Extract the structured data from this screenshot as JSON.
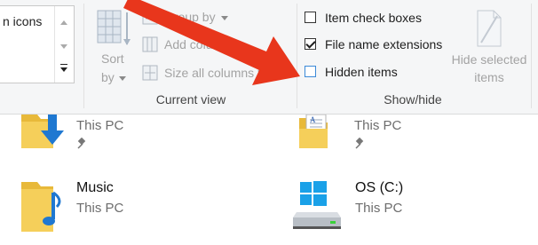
{
  "ribbon": {
    "layout_pane": {
      "icons_label": "n icons"
    },
    "current_view": {
      "sort_by_line1": "Sort",
      "sort_by_line2": "by",
      "group_by": "Group by",
      "add_columns": "Add columns",
      "size_all_columns": "Size all columns to fit",
      "group_label": "Current view"
    },
    "show_hide": {
      "item_check_boxes": {
        "label": "Item check boxes",
        "checked": false
      },
      "file_name_extensions": {
        "label": "File name extensions",
        "checked": true
      },
      "hidden_items": {
        "label": "Hidden items",
        "checked": false
      },
      "hide_selected_line1": "Hide selected",
      "hide_selected_line2": "items",
      "group_label": "Show/hide"
    }
  },
  "content": {
    "items": [
      {
        "name": "",
        "location": "This PC",
        "icon": "downloads-folder-icon"
      },
      {
        "name": "",
        "location": "This PC",
        "icon": "documents-folder-icon"
      },
      {
        "name": "Music",
        "location": "This PC",
        "icon": "music-folder-icon"
      },
      {
        "name": "OS (C:)",
        "location": "This PC",
        "icon": "windows-drive-icon"
      }
    ]
  },
  "colors": {
    "arrow": "#e8361c",
    "ribbon_bg": "#f5f6f7",
    "folder": "#f2c94c",
    "accent_blue": "#1f78d1"
  }
}
